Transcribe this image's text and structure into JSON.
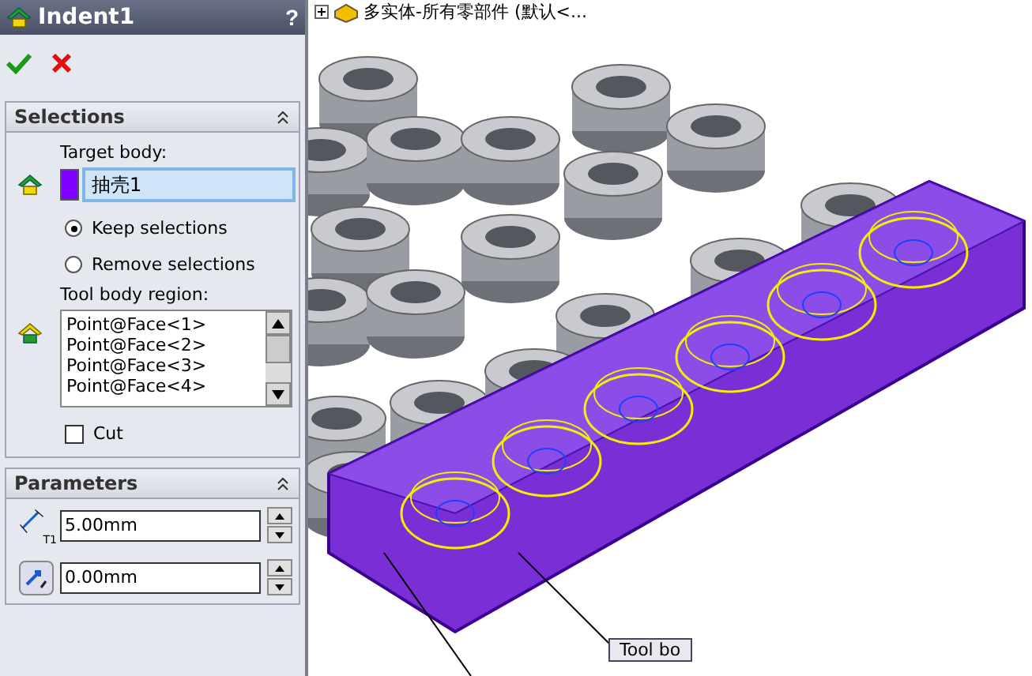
{
  "panel": {
    "title": "Indent1",
    "help": "?",
    "selections": {
      "title": "Selections",
      "target_label": "Target body:",
      "target_value": "抽壳1",
      "options": [
        {
          "label": "Keep selections",
          "selected": true
        },
        {
          "label": "Remove selections",
          "selected": false
        }
      ],
      "tool_label": "Tool body region:",
      "tool_items": [
        "Point@Face<1>",
        "Point@Face<2>",
        "Point@Face<3>",
        "Point@Face<4>"
      ],
      "cut": {
        "label": "Cut",
        "checked": false
      }
    },
    "parameters": {
      "title": "Parameters",
      "fields": [
        {
          "kind": "thickness",
          "icon_label": "T1",
          "value": "5.00mm"
        },
        {
          "kind": "clearance",
          "value": "0.00mm"
        }
      ]
    }
  },
  "tree": {
    "label": "多实体-所有零部件 (默认<...",
    "expanded": false
  },
  "tooltip": "Tool bo"
}
